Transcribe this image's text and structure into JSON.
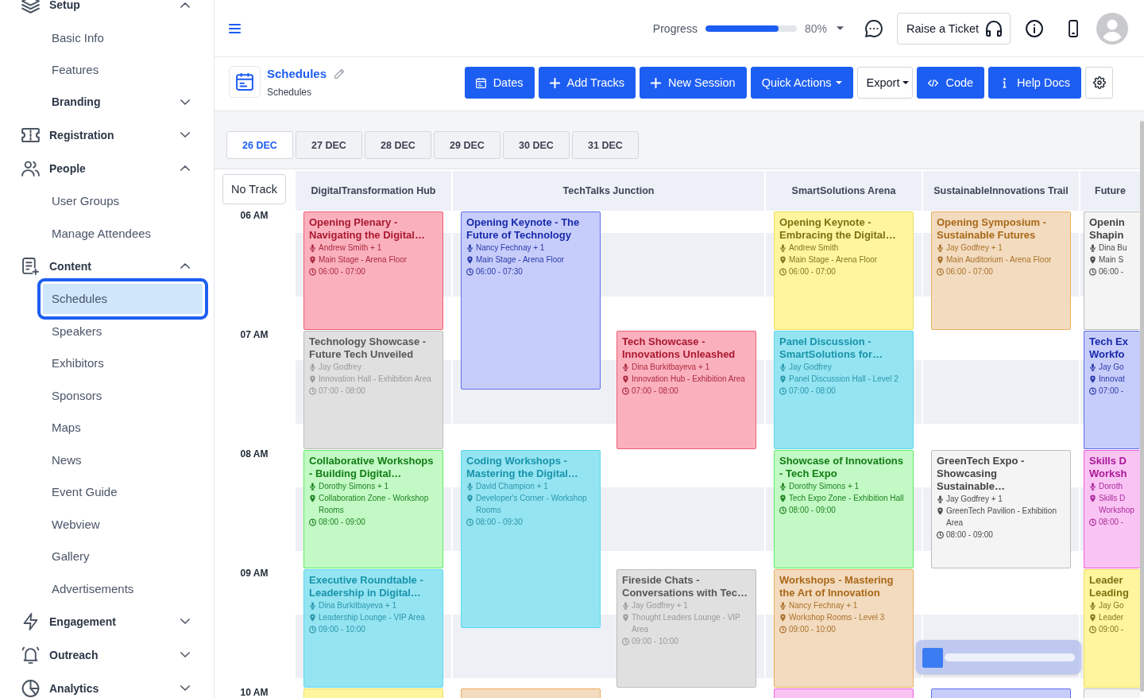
{
  "sidebar": {
    "items": [
      {
        "label": "Setup",
        "expanded": true,
        "selected": false,
        "children": [
          {
            "label": "Basic Info",
            "selected": false
          },
          {
            "label": "Features",
            "selected": false
          },
          {
            "label": "Branding",
            "expanded": false,
            "selected": false
          }
        ]
      },
      {
        "label": "Registration",
        "expanded": false,
        "selected": false
      },
      {
        "label": "People",
        "expanded": true,
        "selected": false,
        "children": [
          {
            "label": "User Groups",
            "selected": false
          },
          {
            "label": "Manage Attendees",
            "selected": false
          }
        ]
      },
      {
        "label": "Content",
        "expanded": true,
        "selected": false,
        "children": [
          {
            "label": "Schedules",
            "selected": true
          },
          {
            "label": "Speakers",
            "selected": false
          },
          {
            "label": "Exhibitors",
            "selected": false
          },
          {
            "label": "Sponsors",
            "selected": false
          },
          {
            "label": "Maps",
            "selected": false
          },
          {
            "label": "News",
            "selected": false
          },
          {
            "label": "Event Guide",
            "selected": false
          },
          {
            "label": "Webview",
            "selected": false
          },
          {
            "label": "Gallery",
            "selected": false
          },
          {
            "label": "Advertisements",
            "selected": false
          }
        ]
      },
      {
        "label": "Engagement",
        "expanded": false,
        "selected": false
      },
      {
        "label": "Outreach",
        "expanded": false,
        "selected": false
      },
      {
        "label": "Analytics",
        "expanded": false,
        "selected": false
      }
    ]
  },
  "header": {
    "progress": {
      "label": "Progress",
      "level": 0.8,
      "reading": "80%"
    },
    "ticket_button": "Raise a Ticket"
  },
  "page": {
    "title": "Schedules",
    "subtitle": "Schedules",
    "buttons": [
      {
        "label": "Dates",
        "kind": "primary",
        "dropdown": false
      },
      {
        "label": "Add Tracks",
        "kind": "primary",
        "dropdown": false
      },
      {
        "label": "New Session",
        "kind": "primary",
        "dropdown": false
      },
      {
        "label": "Quick Actions",
        "kind": "primary",
        "dropdown": true
      },
      {
        "label": "Export",
        "kind": "outline",
        "dropdown": true
      },
      {
        "label": "Code",
        "kind": "primary",
        "dropdown": false
      },
      {
        "label": "Help Docs",
        "kind": "primary",
        "dropdown": false
      }
    ]
  },
  "date_tabs": [
    {
      "label": "26 DEC",
      "selected": true
    },
    {
      "label": "27 DEC",
      "selected": false
    },
    {
      "label": "28 DEC",
      "selected": false
    },
    {
      "label": "29 DEC",
      "selected": false
    },
    {
      "label": "30 DEC",
      "selected": false
    },
    {
      "label": "31 DEC",
      "selected": false
    }
  ],
  "schedule": {
    "no_track": "No Track",
    "times": [
      "06 AM",
      "07 AM",
      "08 AM",
      "09 AM",
      "10 AM"
    ],
    "tracks": [
      {
        "name": "DigitalTransformation Hub",
        "lanes": [
          [
            {
              "title": "Opening Plenary - Navigating the Digital…",
              "speaker": "Andrew Smith + 1",
              "location": "Main Stage - Arena Floor",
              "time": "06:00 - 07:00",
              "color": "#fbb0bd"
            },
            {
              "title": "Technology Showcase - Future Tech Unveiled",
              "speaker": "Jay Godfrey",
              "location": "Innovation Hall - Exhibition Area",
              "time": "07:00 - 08:00",
              "color": "#e0e0e0"
            },
            {
              "title": "Collaborative Workshops - Building Digital…",
              "speaker": "Dorothy Simons + 1",
              "location": "Collaboration Zone - Workshop Rooms",
              "time": "08:00 - 09:00",
              "color": "#c2f9c4"
            },
            {
              "title": "Executive Roundtable - Leadership in Digital…",
              "speaker": "Dina Burkitbayeva + 1",
              "location": "Leadership Lounge - VIP Area",
              "time": "09:00 - 10:00",
              "color": "#95e4f2"
            },
            {
              "color": "#fef59e"
            }
          ]
        ]
      },
      {
        "name": "TechTalks Junction",
        "lanes": [
          [
            {
              "title": "Opening Keynote - The Future of Technology",
              "speaker": "Nancy Fechnay + 1",
              "location": "Main Stage - Arena Floor",
              "time": "06:00 - 07:30",
              "color": "#c7cdfa"
            },
            {
              "title": "Coding Workshops - Mastering the Digital…",
              "speaker": "David Champion + 1",
              "location": "Developer's Corner - Workshop Rooms",
              "time": "08:00 - 09:30",
              "color": "#95e4f2"
            },
            {
              "color": "#f2dbbf"
            }
          ],
          [
            {
              "title": "Tech Showcase - Innovations Unleashed",
              "speaker": "Dina Burkitbayeva + 1",
              "location": "Innovation Hub - Exhibition Area",
              "time": "07:00 - 08:00",
              "color": "#fbb0bd"
            },
            {
              "title": "Fireside Chats - Conversations with Tec…",
              "speaker": "Jay Godfrey + 1",
              "location": "Thought Leaders Lounge - VIP Area",
              "time": "09:00 - 10:00",
              "color": "#e0e0e0"
            }
          ]
        ]
      },
      {
        "name": "SmartSolutions Arena",
        "lanes": [
          [
            {
              "title": "Opening Keynote - Embracing the Digital…",
              "speaker": "Andrew Smith",
              "location": "Main Stage - Arena Floor",
              "time": "06:00 - 07:00",
              "color": "#fef59e"
            },
            {
              "title": "Panel Discussion - SmartSolutions for…",
              "speaker": "Jay Godfrey",
              "location": "Panel Discussion Hall - Level 2",
              "time": "07:00 - 08:00",
              "color": "#95e4f2"
            },
            {
              "title": "Showcase of Innovations - Tech Expo",
              "speaker": "Dorothy Simons + 1",
              "location": "Tech Expo Zone - Exhibition Hall",
              "time": "08:00 - 09:00",
              "color": "#c2f9c4"
            },
            {
              "title": "Workshops - Mastering the Art of Innovation",
              "speaker": "Nancy Fechnay + 1",
              "location": "Workshop Rooms - Level 3",
              "time": "09:00 - 10:00",
              "color": "#f2dbbf"
            },
            {
              "color": "#f9c4f3"
            }
          ]
        ]
      },
      {
        "name": "SustainableInnovations Trail",
        "lanes": [
          [
            {
              "title": "Opening Symposium - Sustainable Futures",
              "speaker": "Jay Godfrey + 1",
              "location": "Main Auditorium - Arena Floor",
              "time": "06:00 - 07:00",
              "color": "#f2dbbf"
            },
            {
              "title": "GreenTech Expo - Showcasing Sustainable…",
              "speaker": "Jay Godfrey + 1",
              "location": "GreenTech Pavilion - Exhibition Area",
              "time": "08:00 - 09:00",
              "color": "#f4f4f4"
            },
            {
              "color": "#c7cdfa"
            }
          ]
        ]
      },
      {
        "name": "Future",
        "lanes": [
          [
            {
              "title": "Openin Shapin",
              "speaker": "Dina Bu",
              "location": "Main S",
              "time": "06:00 -",
              "color": "#f4f4f4"
            },
            {
              "title": "Tech Ex Workfo",
              "speaker": "Jay Go",
              "location": "Innovat",
              "time": "07:00 -",
              "color": "#c7cdfa"
            },
            {
              "title": "Skills D Worksh",
              "speaker": "Doroth",
              "location": "Skills D Workshop",
              "time": "08:00 -",
              "color": "#f9c4f3"
            },
            {
              "title": "Leader Leading",
              "speaker": "Jay Go",
              "location": "Leader",
              "time": "09:00 -",
              "color": "#fef59e"
            },
            {
              "color": "#f4f4f4"
            }
          ]
        ]
      }
    ]
  }
}
